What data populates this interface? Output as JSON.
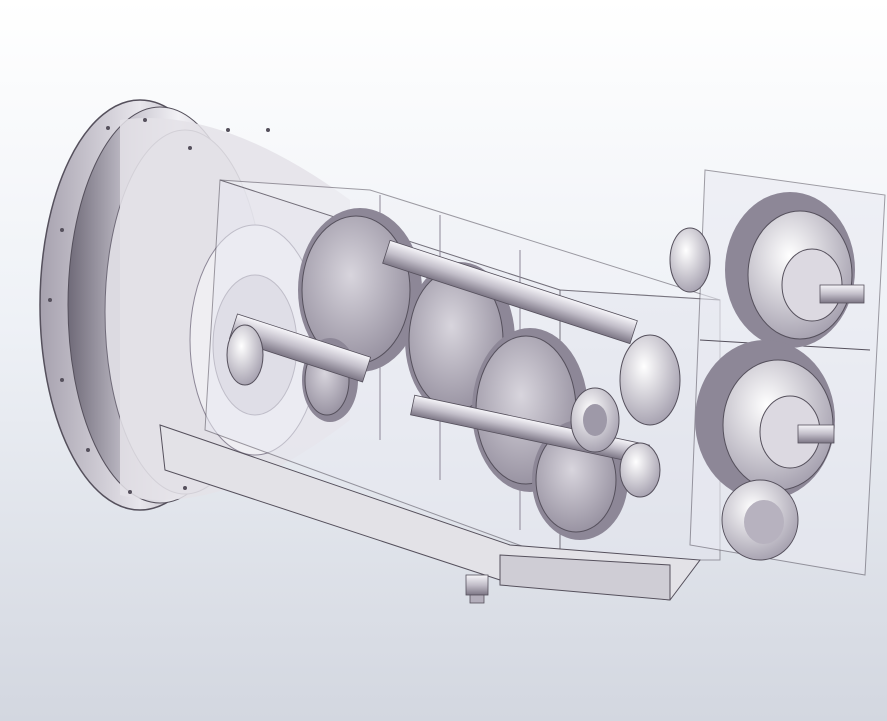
{
  "viewport": {
    "view_mode": "cad-3d-viewport",
    "background_top": "#ffffff",
    "background_bottom": "#d3d7e0"
  },
  "model": {
    "render_style": "transparent-shaded",
    "palette": {
      "metal_light": "#f2f1f5",
      "metal_mid": "#c9c6d0",
      "metal_dark": "#6f6a78",
      "gear_face": "#b7b2bf",
      "gear_teeth": "#8d8797",
      "housing_glass": "#e9eaf2",
      "edge_line": "#55505c",
      "base_plate": "#e3e2e7"
    },
    "visible_parts": [
      "flywheel",
      "gearbox-housing",
      "gear-train",
      "output-housing",
      "output-shafts",
      "base-plate",
      "drain-plug"
    ]
  }
}
